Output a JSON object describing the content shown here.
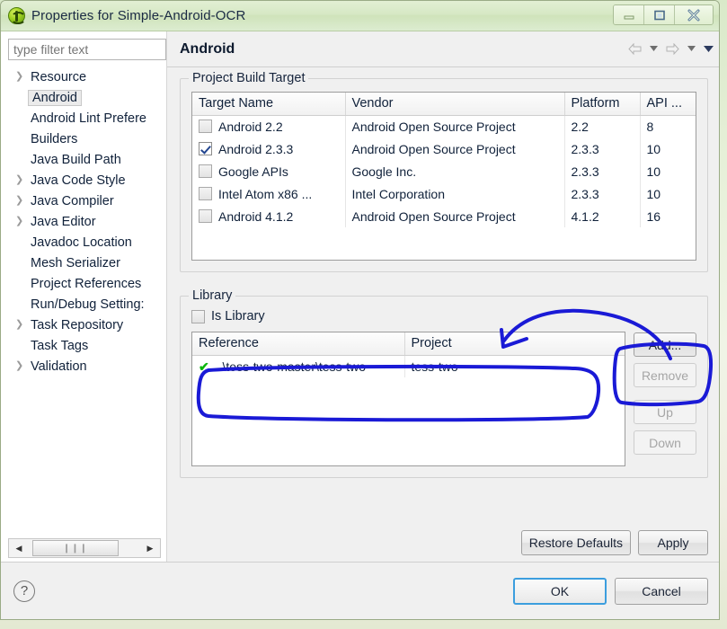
{
  "window": {
    "title": "Properties for Simple-Android-OCR",
    "icon": "eclipse-icon",
    "minimize_label": "Minimize",
    "maximize_label": "Maximize",
    "close_label": "Close"
  },
  "sidebar": {
    "filter_placeholder": "type filter text",
    "filter_value": "",
    "items": [
      {
        "label": "Resource",
        "expandable": true,
        "selected": false
      },
      {
        "label": "Android",
        "expandable": false,
        "selected": true
      },
      {
        "label": "Android Lint Prefere",
        "expandable": false,
        "selected": false
      },
      {
        "label": "Builders",
        "expandable": false,
        "selected": false
      },
      {
        "label": "Java Build Path",
        "expandable": false,
        "selected": false
      },
      {
        "label": "Java Code Style",
        "expandable": true,
        "selected": false
      },
      {
        "label": "Java Compiler",
        "expandable": true,
        "selected": false
      },
      {
        "label": "Java Editor",
        "expandable": true,
        "selected": false
      },
      {
        "label": "Javadoc Location",
        "expandable": false,
        "selected": false
      },
      {
        "label": "Mesh Serializer",
        "expandable": false,
        "selected": false
      },
      {
        "label": "Project References",
        "expandable": false,
        "selected": false
      },
      {
        "label": "Run/Debug Setting:",
        "expandable": false,
        "selected": false
      },
      {
        "label": "Task Repository",
        "expandable": true,
        "selected": false
      },
      {
        "label": "Task Tags",
        "expandable": false,
        "selected": false
      },
      {
        "label": "Validation",
        "expandable": true,
        "selected": false
      }
    ],
    "hscroll": {
      "left_arrow": "◀",
      "right_arrow": "▶",
      "thumb_grip": "❙❙❙"
    }
  },
  "page": {
    "title": "Android",
    "nav": {
      "back": "back-arrow",
      "back_menu": "back-dropdown",
      "forward": "forward-arrow",
      "forward_menu": "forward-dropdown",
      "view_menu": "view-menu-dropdown"
    }
  },
  "build_target": {
    "legend": "Project Build Target",
    "columns": [
      "Target Name",
      "Vendor",
      "Platform",
      "API ..."
    ],
    "rows": [
      {
        "checked": false,
        "name": "Android 2.2",
        "vendor": "Android Open Source Project",
        "platform": "2.2",
        "api": "8"
      },
      {
        "checked": true,
        "name": "Android 2.3.3",
        "vendor": "Android Open Source Project",
        "platform": "2.3.3",
        "api": "10"
      },
      {
        "checked": false,
        "name": "Google APIs",
        "vendor": "Google Inc.",
        "platform": "2.3.3",
        "api": "10"
      },
      {
        "checked": false,
        "name": "Intel Atom x86 ...",
        "vendor": "Intel Corporation",
        "platform": "2.3.3",
        "api": "10"
      },
      {
        "checked": false,
        "name": "Android 4.1.2",
        "vendor": "Android Open Source Project",
        "platform": "4.1.2",
        "api": "16"
      }
    ]
  },
  "library": {
    "legend": "Library",
    "is_library_label": "Is Library",
    "is_library_checked": false,
    "columns": [
      "Reference",
      "Project"
    ],
    "rows": [
      {
        "status": "ok",
        "reference": "..\\tess-two-master\\tess-two",
        "project": "tess-two"
      }
    ],
    "buttons": [
      {
        "label": "Add...",
        "enabled": true
      },
      {
        "label": "Remove",
        "enabled": false
      },
      {
        "label": "Up",
        "enabled": false
      },
      {
        "label": "Down",
        "enabled": false
      }
    ]
  },
  "actions": {
    "restore_defaults": "Restore Defaults",
    "apply": "Apply",
    "ok": "OK",
    "cancel": "Cancel",
    "help": "?"
  },
  "annotations": {
    "color": "#1a1ad6",
    "shapes": [
      "arrow-pointing-to-reference-table",
      "box-around-reference-row",
      "box-around-add-button"
    ]
  },
  "colors": {
    "titlebar": "#d6e8c4",
    "dialog_bg": "#f0f0f0",
    "accent_default_button": "#3c9ede",
    "annotation_blue": "#1a1ad6",
    "check_green": "#0bb60b"
  }
}
